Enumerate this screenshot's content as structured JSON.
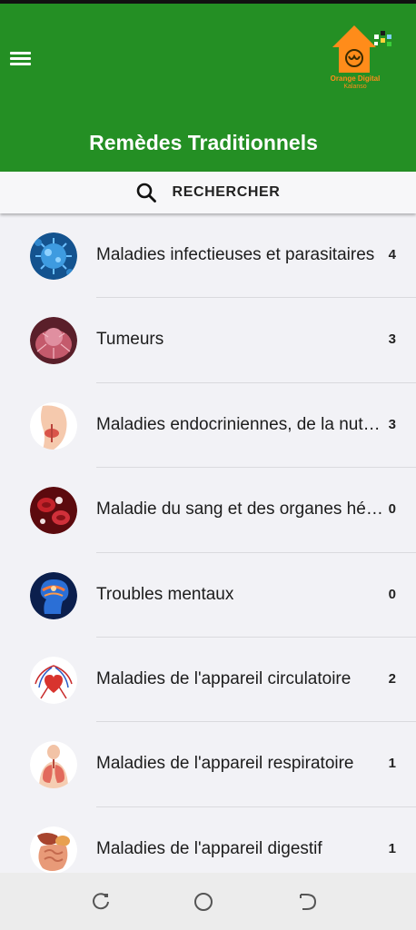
{
  "app_bar": {
    "title": "Remèdes Traditionnels",
    "logo_line1": "Orange Digital",
    "logo_line2": "Kalanso",
    "color": "#248f24"
  },
  "search": {
    "label": "RECHERCHER"
  },
  "categories": [
    {
      "label": "Maladies infectieuses et parasitaires",
      "count": "4",
      "icon": "virus-icon",
      "color": "#1f6fb8"
    },
    {
      "label": "Tumeurs",
      "count": "3",
      "icon": "tumor-icon",
      "color": "#b84a5c"
    },
    {
      "label": "Maladies endocriniennes, de la nutrition et métaboliques",
      "count": "3",
      "icon": "thyroid-icon",
      "color": "#f2c3a6"
    },
    {
      "label": "Maladie du sang et des organes hématopoïétiques",
      "count": "0",
      "icon": "blood-cells-icon",
      "color": "#a3141c"
    },
    {
      "label": "Troubles mentaux",
      "count": "0",
      "icon": "brain-icon",
      "color": "#1b4fa0"
    },
    {
      "label": "Maladies de l'appareil circulatoire",
      "count": "2",
      "icon": "heart-icon",
      "color": "#cf2a2a"
    },
    {
      "label": "Maladies de l'appareil respiratoire",
      "count": "1",
      "icon": "lungs-icon",
      "color": "#e88a7a"
    },
    {
      "label": "Maladies de l'appareil digestif",
      "count": "1",
      "icon": "digestive-system-icon",
      "color": "#d9883a"
    }
  ]
}
